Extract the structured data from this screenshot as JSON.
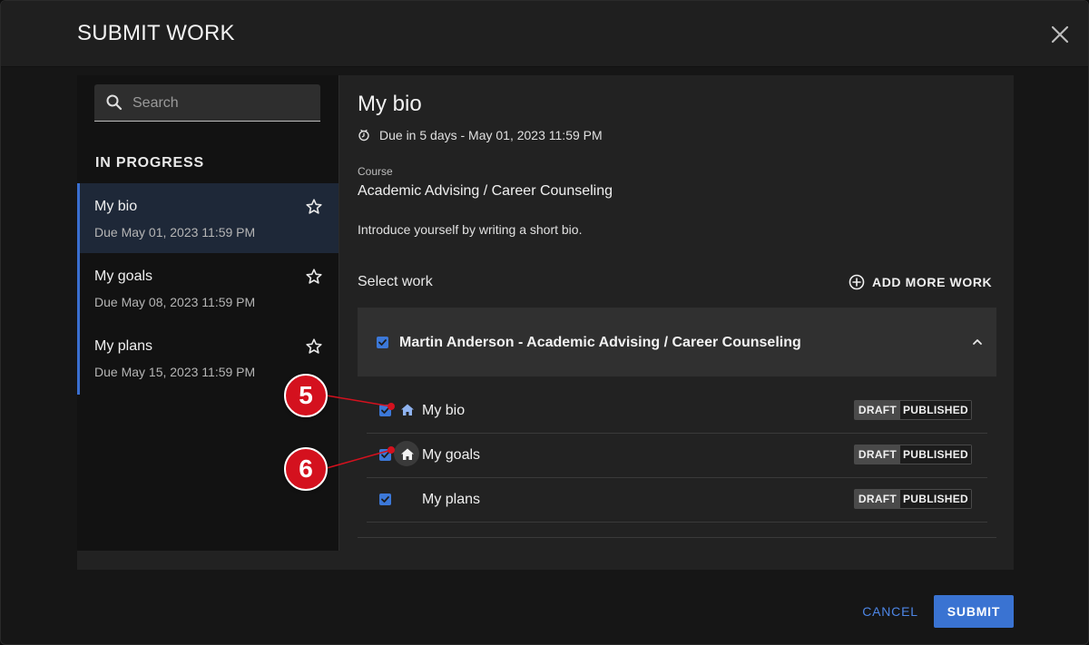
{
  "modal": {
    "title": "SUBMIT WORK",
    "close_icon": "close-icon"
  },
  "sidebar": {
    "search": {
      "placeholder": "Search",
      "value": ""
    },
    "section_label": "IN PROGRESS",
    "items": [
      {
        "title": "My bio",
        "due": "Due May 01, 2023 11:59 PM",
        "selected": true
      },
      {
        "title": "My goals",
        "due": "Due May 08, 2023 11:59 PM",
        "selected": false
      },
      {
        "title": "My plans",
        "due": "Due May 15, 2023 11:59 PM",
        "selected": false
      }
    ]
  },
  "detail": {
    "title": "My bio",
    "due": "Due in 5 days - May 01, 2023 11:59 PM",
    "course_label": "Course",
    "course_value": "Academic Advising / Career Counseling",
    "description": "Introduce yourself by writing a short bio.",
    "select_work_label": "Select work",
    "add_more_label": "ADD MORE WORK",
    "group": {
      "title": "Martin Anderson - Academic Advising / Career Counseling",
      "checked": true,
      "works": [
        {
          "title": "My bio",
          "checked": true,
          "icon": "home-icon",
          "draft": "DRAFT",
          "published": "PUBLISHED"
        },
        {
          "title": "My goals",
          "checked": true,
          "icon": "home-icon",
          "draft": "DRAFT",
          "published": "PUBLISHED"
        },
        {
          "title": "My plans",
          "checked": true,
          "icon": "",
          "draft": "DRAFT",
          "published": "PUBLISHED"
        }
      ]
    }
  },
  "annotations": [
    "5",
    "6"
  ],
  "footer": {
    "cancel_label": "CANCEL",
    "submit_label": "SUBMIT"
  },
  "colors": {
    "accent": "#3a73d2",
    "annotation": "#d4111e"
  }
}
